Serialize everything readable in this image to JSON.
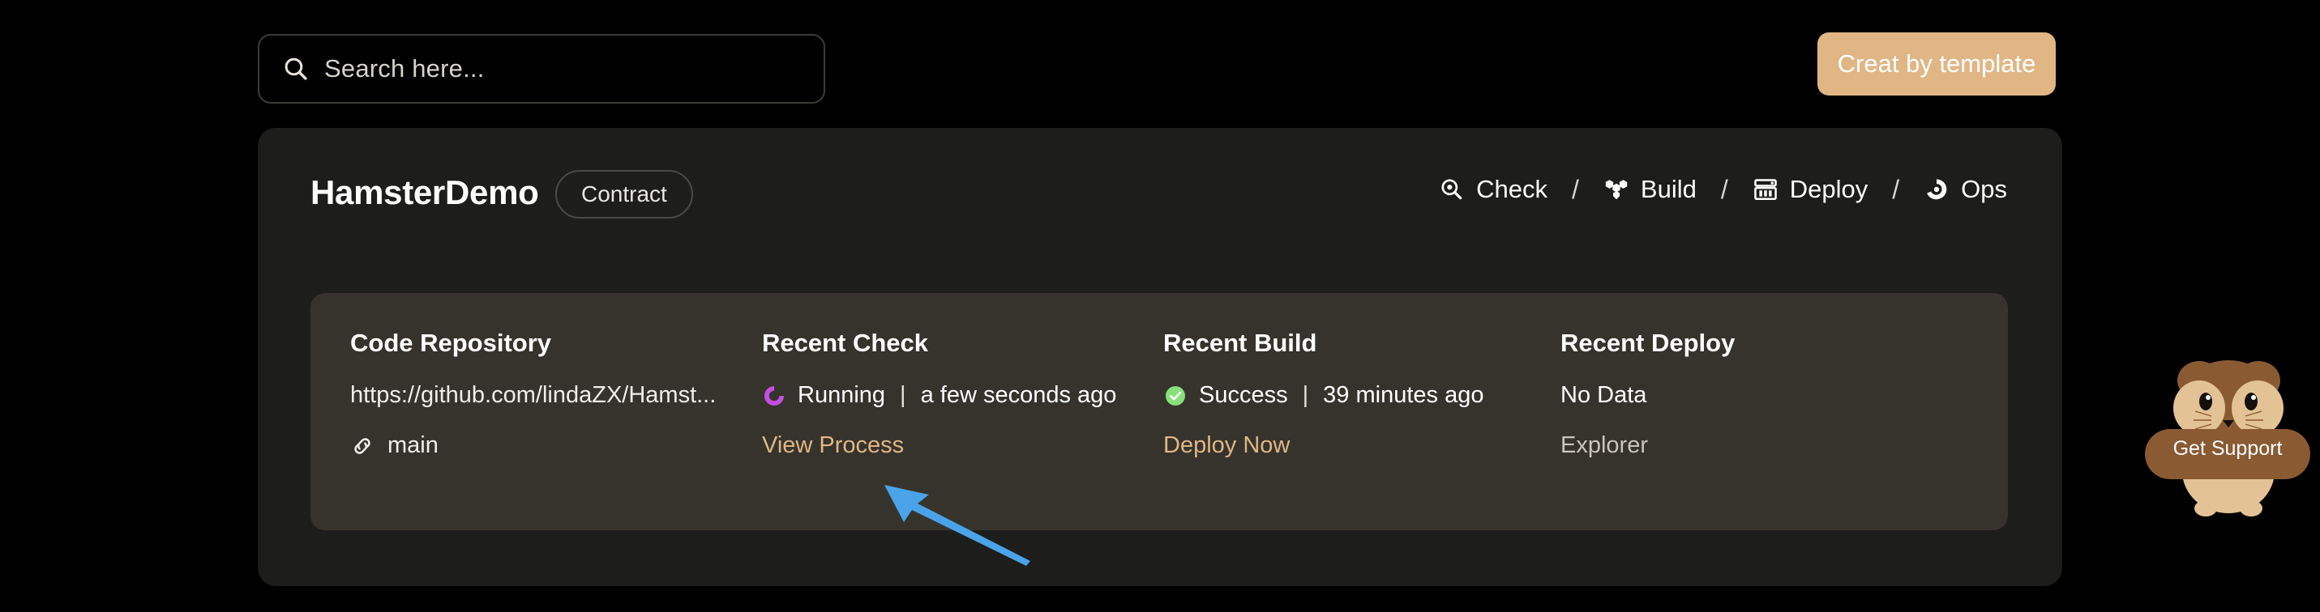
{
  "topbar": {
    "search": {
      "icon": "search-icon",
      "value": "",
      "placeholder": "Search here..."
    },
    "create_button": {
      "label": "Creat by template",
      "background": "#dfb684",
      "text_color": "#ffffff"
    }
  },
  "panel": {
    "project_title": "HamsterDemo",
    "badge": "Contract",
    "nav": {
      "separator": "/",
      "items": [
        {
          "label": "Check",
          "icon": "magnifier-target-icon"
        },
        {
          "label": "Build",
          "icon": "hexagon-cluster-icon"
        },
        {
          "label": "Deploy",
          "icon": "server-rack-icon"
        },
        {
          "label": "Ops",
          "icon": "triskelion-circle-icon"
        }
      ]
    },
    "columns": [
      {
        "title": "Code Repository",
        "value": "https://github.com/lindaZX/Hamst...",
        "value_icon": "",
        "action": "main",
        "action_icon": "chain-link-icon",
        "action_style": "plain"
      },
      {
        "title": "Recent Check",
        "status": "Running",
        "status_icon": "spinner-icon",
        "status_icon_color": "#c44fe0",
        "separator": "|",
        "timestamp": "a few seconds ago",
        "action": "View Process",
        "action_style": "accent"
      },
      {
        "title": "Recent Build",
        "status": "Success",
        "status_icon": "check-circle-icon",
        "status_icon_color": "#86e07a",
        "separator": "|",
        "timestamp": "39 minutes ago",
        "action": "Deploy Now",
        "action_style": "accent"
      },
      {
        "title": "Recent Deploy",
        "status": "No Data",
        "status_icon": "",
        "separator": "",
        "timestamp": "",
        "action": "Explorer",
        "action_style": "muted"
      }
    ]
  },
  "annotation": {
    "arrow_color": "#4aa3e8",
    "points_to": "View Process"
  },
  "support_widget": {
    "label": "Get Support",
    "icon": "hamster-mascot-icon",
    "body_color": "#8a5a33",
    "face_color": "#e3c295"
  },
  "theme": {
    "page_background": "#000000",
    "panel_background": "#1d1d1b",
    "card_background": "#36332d",
    "accent": "#dfb684",
    "text_primary": "#ffffff",
    "text_muted": "#c9c5bc"
  }
}
